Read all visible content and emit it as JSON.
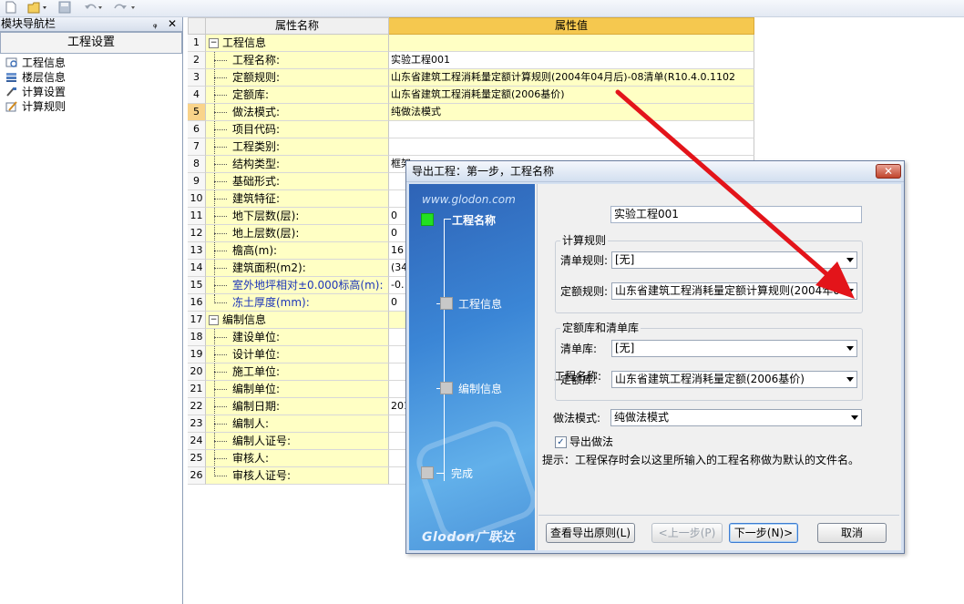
{
  "toolbar": {
    "new_icon": "new-file-icon",
    "open_icon": "open-folder-icon",
    "save_icon": "save-icon",
    "undo_icon": "undo-icon",
    "redo_icon": "redo-icon"
  },
  "nav": {
    "title": "模块导航栏",
    "pin_glyph": "ᵩ",
    "close_glyph": "✕",
    "tab": "工程设置",
    "items": [
      {
        "label": "工程信息",
        "icon": "project-info-icon"
      },
      {
        "label": "楼层信息",
        "icon": "floor-info-icon"
      },
      {
        "label": "计算设置",
        "icon": "calc-settings-icon"
      },
      {
        "label": "计算规则",
        "icon": "calc-rules-icon"
      }
    ]
  },
  "grid": {
    "col_name": "属性名称",
    "col_value": "属性值",
    "expand_glyph": "−",
    "rows": [
      {
        "n": "1",
        "label": "工程信息",
        "value": "",
        "group": true
      },
      {
        "n": "2",
        "label": "工程名称:",
        "value": "实验工程001"
      },
      {
        "n": "3",
        "label": "定额规则:",
        "value": "山东省建筑工程消耗量定额计算规则(2004年04月后)-08清单(R10.4.0.1102"
      },
      {
        "n": "4",
        "label": "定额库:",
        "value": "山东省建筑工程消耗量定额(2006基价)"
      },
      {
        "n": "5",
        "label": "做法模式:",
        "value": "纯做法模式"
      },
      {
        "n": "6",
        "label": "项目代码:",
        "value": ""
      },
      {
        "n": "7",
        "label": "工程类别:",
        "value": ""
      },
      {
        "n": "8",
        "label": "结构类型:",
        "value": "框架"
      },
      {
        "n": "9",
        "label": "基础形式:",
        "value": ""
      },
      {
        "n": "10",
        "label": "建筑特征:",
        "value": ""
      },
      {
        "n": "11",
        "label": "地下层数(层):",
        "value": "0"
      },
      {
        "n": "12",
        "label": "地上层数(层):",
        "value": "0"
      },
      {
        "n": "13",
        "label": "檐高(m):",
        "value": "16"
      },
      {
        "n": "14",
        "label": "建筑面积(m2):",
        "value": "(34"
      },
      {
        "n": "15",
        "label": "室外地坪相对±0.000标高(m):",
        "value": "-0.",
        "blue": true
      },
      {
        "n": "16",
        "label": "冻土厚度(mm):",
        "value": "0",
        "blue": true
      },
      {
        "n": "17",
        "label": "编制信息",
        "value": "",
        "group": true
      },
      {
        "n": "18",
        "label": "建设单位:",
        "value": ""
      },
      {
        "n": "19",
        "label": "设计单位:",
        "value": ""
      },
      {
        "n": "20",
        "label": "施工单位:",
        "value": ""
      },
      {
        "n": "21",
        "label": "编制单位:",
        "value": ""
      },
      {
        "n": "22",
        "label": "编制日期:",
        "value": "201"
      },
      {
        "n": "23",
        "label": "编制人:",
        "value": ""
      },
      {
        "n": "24",
        "label": "编制人证号:",
        "value": ""
      },
      {
        "n": "25",
        "label": "审核人:",
        "value": ""
      },
      {
        "n": "26",
        "label": "审核人证号:",
        "value": ""
      }
    ]
  },
  "dialog": {
    "title": "导出工程：第一步，工程名称",
    "close_glyph": "✕",
    "banner_url": "www.glodon.com",
    "banner_logo": "Glodon广联达",
    "steps": [
      "工程名称",
      "工程信息",
      "编制信息",
      "完成"
    ],
    "project_name_label": "工程名称:",
    "project_name_value": "实验工程001",
    "calc_group": "计算规则",
    "bill_rule_label": "清单规则:",
    "bill_rule_value": "[无]",
    "quota_rule_label": "定额规则:",
    "quota_rule_value": "山东省建筑工程消耗量定额计算规则(2004年04",
    "lib_group": "定额库和清单库",
    "bill_lib_label": "清单库:",
    "bill_lib_value": "[无]",
    "quota_lib_label": "定额库:",
    "quota_lib_value": "山东省建筑工程消耗量定额(2006基价)",
    "mode_label": "做法模式:",
    "mode_value": "纯做法模式",
    "export_check_label": "导出做法",
    "check_glyph": "✓",
    "hint": "提示：工程保存时会以这里所输入的工程名称做为默认的文件名。",
    "btn_view": "查看导出原则(L)",
    "btn_prev": "<上一步(P)",
    "btn_next": "下一步(N)>",
    "btn_cancel": "取消"
  },
  "colors": {
    "header_value_bg": "#f5c84f",
    "name_cell_bg": "#ffffc4",
    "arrow": "#e3141a",
    "active_step": "#22e022"
  }
}
